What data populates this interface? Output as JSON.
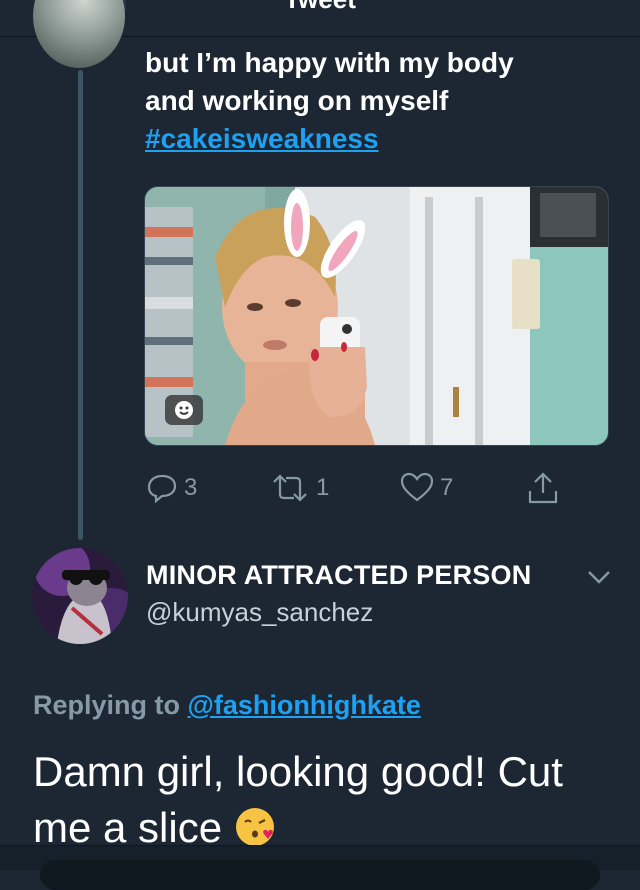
{
  "header": {
    "title": "Tweet"
  },
  "tweet": {
    "text_line1": "but I’m happy with my body",
    "text_line2": "and working on myself",
    "hashtag": "#cakeisweakness",
    "stats": {
      "replies": "3",
      "retweets": "1",
      "likes": "7"
    }
  },
  "reply": {
    "display_name": "MINOR ATTRACTED PERSON",
    "handle": "@kumyas_sanchez",
    "replying_to_prefix": "Replying to",
    "replying_to_handle": "@fashionhighkate",
    "text": "Damn girl, looking good! Cut me a slice"
  },
  "icons": {
    "reply": "reply-icon",
    "retweet": "retweet-icon",
    "like": "heart-icon",
    "share": "share-icon",
    "sticker": "sticker-icon",
    "caret": "chevron-down-icon"
  },
  "colors": {
    "background": "#1c2733",
    "accent": "#1da1f2",
    "muted": "#8899a6"
  }
}
